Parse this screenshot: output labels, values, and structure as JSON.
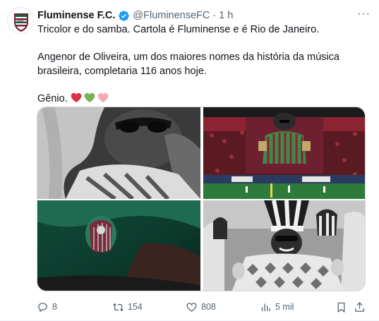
{
  "account": {
    "name": "Fluminense F.C.",
    "handle": "@FluminenseFC",
    "separator": "·",
    "time": "1 h",
    "verified": true,
    "avatar_icon": "fluminense-crest"
  },
  "tweet": {
    "line1": "Tricolor e do samba. Cartola é Fluminense e é Rio de Janeiro.",
    "line2": "Angenor de Oliveira, um dos maiores nomes da história da música brasileira, completaria 116 anos hoje.",
    "line3": "Gênio.",
    "emoji": [
      "red-heart",
      "green-heart",
      "pink-heart"
    ]
  },
  "media": [
    {
      "alt_icon": "bw-portrait-photo"
    },
    {
      "alt_icon": "stadium-tifo-photo"
    },
    {
      "alt_icon": "green-jersey-sleeve-photo"
    },
    {
      "alt_icon": "bw-carnival-photo"
    }
  ],
  "actions": {
    "replies": "8",
    "reposts": "154",
    "likes": "808",
    "views": "5 mil"
  },
  "colors": {
    "text": "#0f1419",
    "muted": "#536471",
    "verified": "#1d9bf0",
    "fluminense_maroon": "#7a1f33",
    "fluminense_green": "#006b3f"
  }
}
